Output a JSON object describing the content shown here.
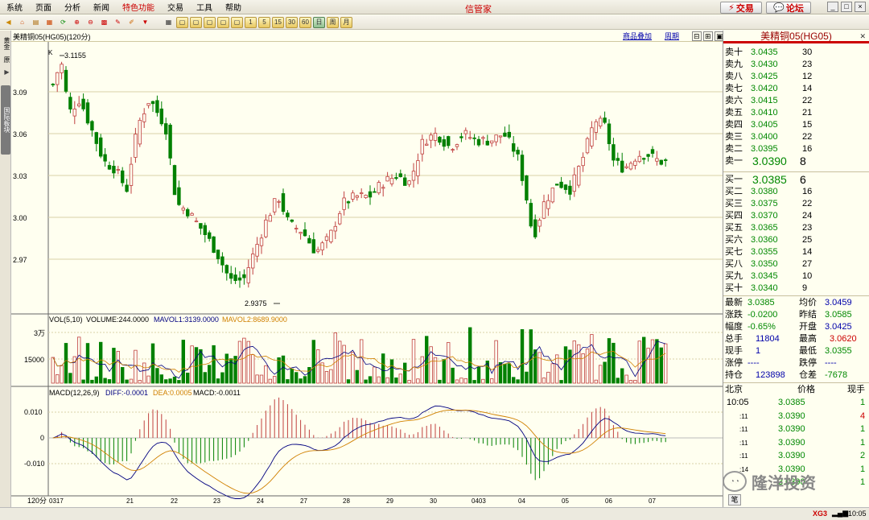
{
  "menu": [
    "系统",
    "页面",
    "分析",
    "新闻",
    "特色功能",
    "交易",
    "工具",
    "帮助"
  ],
  "app_title": "信管家",
  "top_buttons": {
    "trade": "交易",
    "forum": "论坛"
  },
  "toolbar_text": [
    "1",
    "5",
    "15",
    "30",
    "60",
    "日",
    "周",
    "月"
  ],
  "side": {
    "tab1": "黄金",
    "tab1b": "原",
    "tab2": "国际板块"
  },
  "chart_header": {
    "left": "美精铜05(HG05)(120分)",
    "link1": "商品叠加",
    "link2": "周期"
  },
  "chart_data": [
    {
      "type": "candlestick",
      "title": "美精铜05(HG05)(120分)",
      "label": "K",
      "ylim": [
        2.94,
        3.12
      ],
      "y_ticks": [
        "3.09",
        "3.06",
        "3.03",
        "3.00",
        "2.97"
      ],
      "annotations": {
        "high": "3.1155",
        "low": "2.9375"
      },
      "x_ticks": [
        "0317",
        "21",
        "22",
        "23",
        "24",
        "27",
        "28",
        "29",
        "30",
        "0403",
        "04",
        "05",
        "06",
        "07"
      ],
      "x_axis_label": "120分"
    },
    {
      "type": "bar",
      "title": "VOL(5,10)",
      "legend": [
        "VOLUME:244.0000",
        "MAVOL1:3139.0000",
        "MAVOL2:8689.9000"
      ],
      "y_ticks": [
        "3万",
        "15000"
      ]
    },
    {
      "type": "bar",
      "title": "MACD(12,26,9)",
      "legend": [
        "DIFF:-0.0001",
        "DEA:0.0005",
        "MACD:-0.0011"
      ],
      "y_ticks": [
        "0.010",
        "0",
        "-0.010"
      ]
    }
  ],
  "quote": {
    "title": "美精铜05(HG05)",
    "asks": [
      [
        "卖十",
        "3.0435",
        "30"
      ],
      [
        "卖九",
        "3.0430",
        "23"
      ],
      [
        "卖八",
        "3.0425",
        "12"
      ],
      [
        "卖七",
        "3.0420",
        "14"
      ],
      [
        "卖六",
        "3.0415",
        "22"
      ],
      [
        "卖五",
        "3.0410",
        "21"
      ],
      [
        "卖四",
        "3.0405",
        "15"
      ],
      [
        "卖三",
        "3.0400",
        "22"
      ],
      [
        "卖二",
        "3.0395",
        "16"
      ],
      [
        "卖一",
        "3.0390",
        "8"
      ]
    ],
    "bids": [
      [
        "买一",
        "3.0385",
        "6"
      ],
      [
        "买二",
        "3.0380",
        "16"
      ],
      [
        "买三",
        "3.0375",
        "22"
      ],
      [
        "买四",
        "3.0370",
        "24"
      ],
      [
        "买五",
        "3.0365",
        "23"
      ],
      [
        "买六",
        "3.0360",
        "25"
      ],
      [
        "买七",
        "3.0355",
        "14"
      ],
      [
        "买八",
        "3.0350",
        "27"
      ],
      [
        "买九",
        "3.0345",
        "10"
      ],
      [
        "买十",
        "3.0340",
        "9"
      ]
    ],
    "stats": [
      [
        "最新",
        "3.0385",
        "均价",
        "3.0459"
      ],
      [
        "涨跌",
        "-0.0200",
        "昨结",
        "3.0585"
      ],
      [
        "幅度",
        "-0.65%",
        "开盘",
        "3.0425"
      ],
      [
        "总手",
        "11804",
        "最高",
        "3.0620"
      ],
      [
        "现手",
        "1",
        "最低",
        "3.0355"
      ],
      [
        "涨停",
        "----",
        "跌停",
        "----"
      ],
      [
        "持仓",
        "123898",
        "仓差",
        "-7678"
      ]
    ],
    "ticks_header": [
      "北京",
      "价格",
      "现手"
    ],
    "ticks": [
      [
        "10:05",
        "3.0385",
        "1"
      ],
      [
        ":11",
        "3.0390",
        "4"
      ],
      [
        ":11",
        "3.0390",
        "1"
      ],
      [
        ":11",
        "3.0390",
        "1"
      ],
      [
        ":11",
        "3.0390",
        "2"
      ],
      [
        ":14",
        "3.0390",
        "1"
      ],
      [
        "",
        "3.0390",
        "1"
      ]
    ],
    "bottom_tab": "笔"
  },
  "watermark": "隆洋投资",
  "status": {
    "signal": "XG3",
    "time": "10:05"
  }
}
